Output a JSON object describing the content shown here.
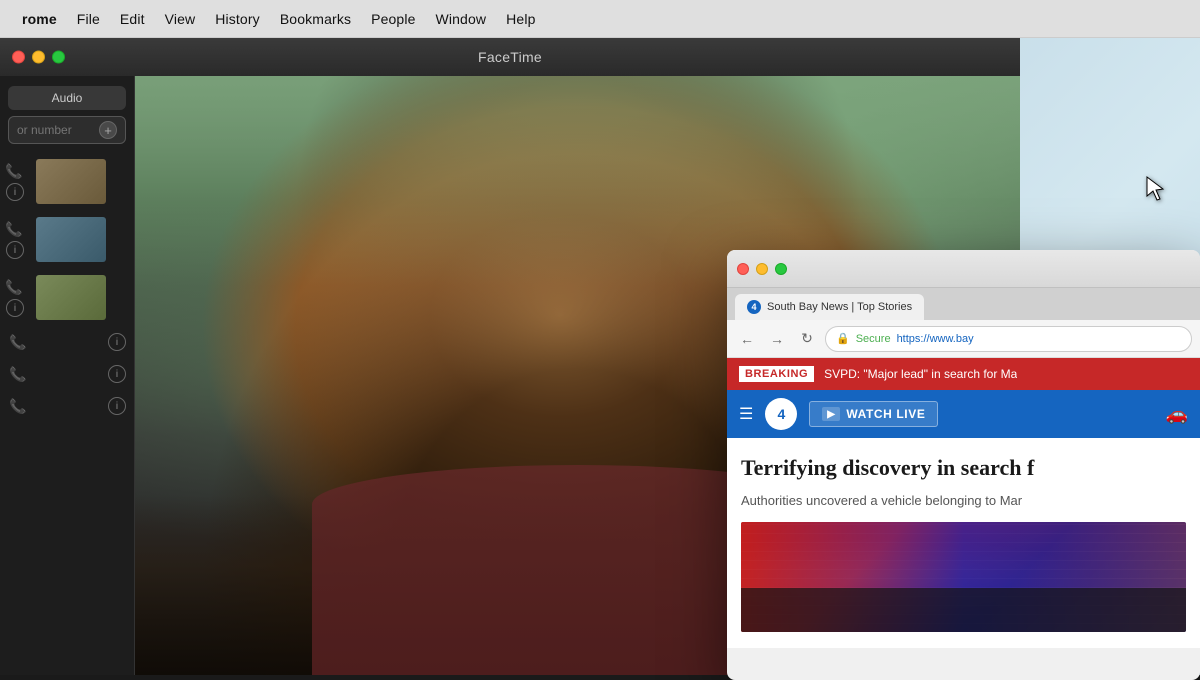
{
  "menubar": {
    "items": [
      {
        "id": "chrome",
        "label": "rome",
        "bold": true
      },
      {
        "id": "file",
        "label": "File"
      },
      {
        "id": "edit",
        "label": "Edit"
      },
      {
        "id": "view",
        "label": "View"
      },
      {
        "id": "history",
        "label": "History"
      },
      {
        "id": "bookmarks",
        "label": "Bookmarks"
      },
      {
        "id": "people",
        "label": "People"
      },
      {
        "id": "window",
        "label": "Window"
      },
      {
        "id": "help",
        "label": "Help"
      }
    ]
  },
  "facetime": {
    "title": "FaceTime",
    "sidebar": {
      "audio_button": "Audio",
      "search_placeholder": "or number",
      "contacts": [
        {
          "id": 1
        },
        {
          "id": 2
        },
        {
          "id": 3
        },
        {
          "id": 4
        },
        {
          "id": 5
        },
        {
          "id": 6
        }
      ]
    }
  },
  "browser": {
    "tab_title": "South Bay News | Top Stories",
    "nav": {
      "back_label": "←",
      "forward_label": "→",
      "refresh_label": "↻",
      "secure_label": "Secure",
      "url": "https://www.bay"
    },
    "breaking_news": {
      "label": "BREAKING",
      "text": "SVPD: \"Major lead\" in search for Ma"
    },
    "watch_live_label": "WATCH LIVE",
    "headline": "Terrifying discovery in search f",
    "subtext": "Authorities uncovered a vehicle belonging to Mar",
    "logo_text": "4"
  },
  "cursor": {
    "symbol": "↗"
  }
}
